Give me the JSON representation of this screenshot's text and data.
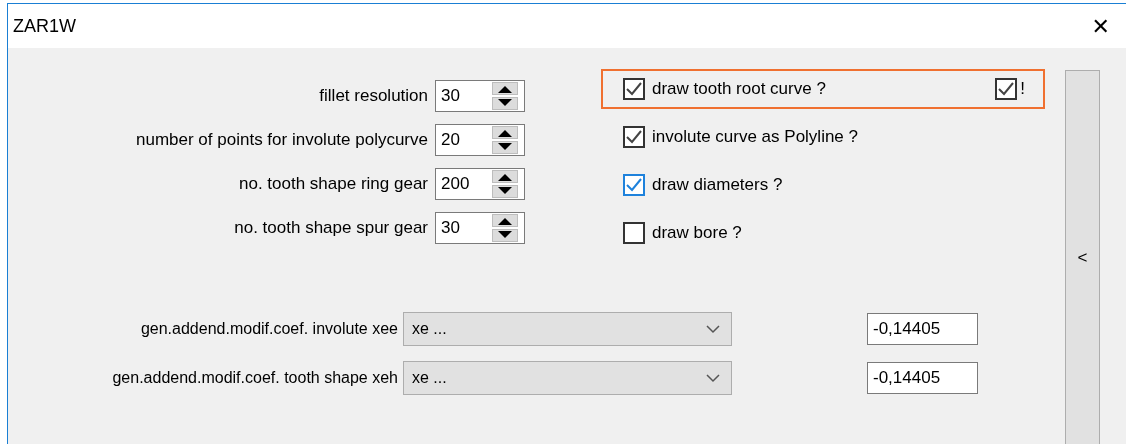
{
  "window": {
    "title": "ZAR1W",
    "close": "✕"
  },
  "spinners": [
    {
      "label": "fillet resolution",
      "value": "30"
    },
    {
      "label": "number of points for involute polycurve",
      "value": "20"
    },
    {
      "label": "no. tooth shape ring gear",
      "value": "200"
    },
    {
      "label": "no. tooth shape spur gear",
      "value": "30"
    }
  ],
  "checkboxes": [
    {
      "label": "draw tooth root curve ?",
      "checked": true,
      "focused": false,
      "highlighted": true,
      "flag": {
        "label": "!",
        "checked": true
      }
    },
    {
      "label": "involute curve as Polyline ?",
      "checked": true,
      "focused": false,
      "highlighted": false
    },
    {
      "label": "draw diameters ?",
      "checked": true,
      "focused": true,
      "highlighted": false
    },
    {
      "label": "draw bore ?",
      "checked": false,
      "focused": false,
      "highlighted": false
    }
  ],
  "dropdown_rows": [
    {
      "label": "gen.addend.modif.coef. involute xee",
      "selection": "xe ...",
      "value": "-0,14405"
    },
    {
      "label": "gen.addend.modif.coef. tooth shape xeh",
      "selection": "xe ...",
      "value": "-0,14405"
    }
  ],
  "side_panel": {
    "toggle": "<"
  }
}
